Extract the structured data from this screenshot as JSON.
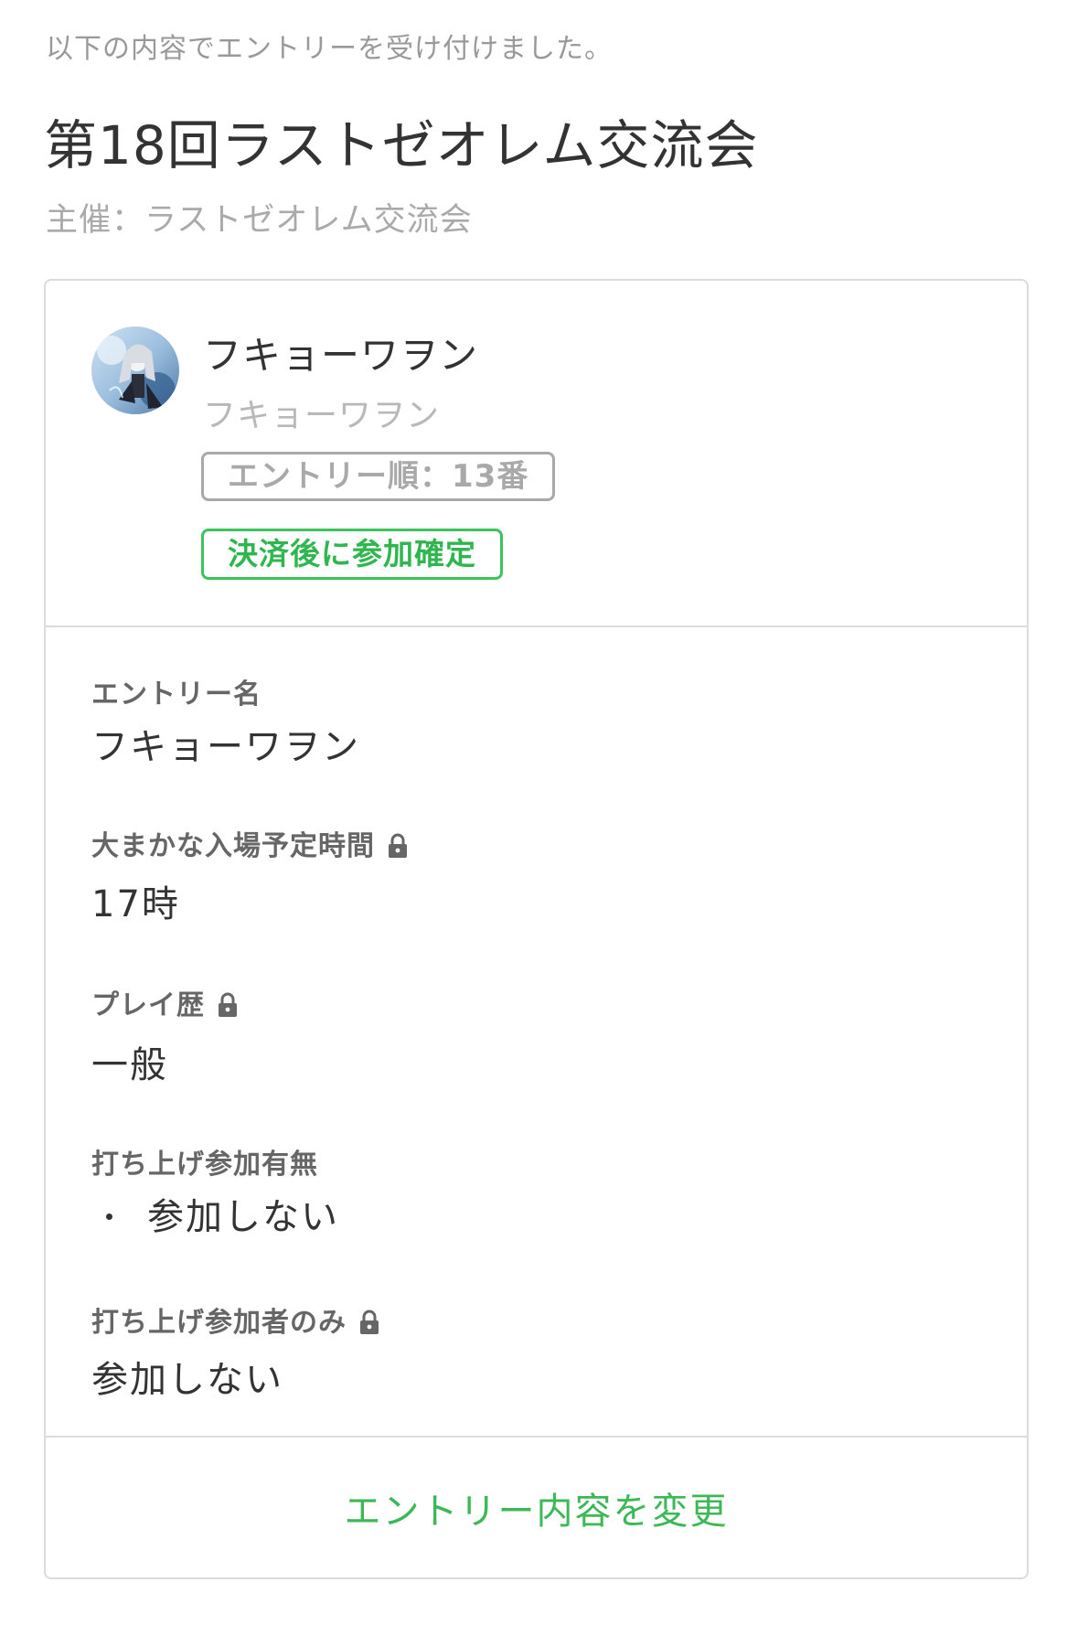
{
  "notice": "以下の内容でエントリーを受け付けました。",
  "event": {
    "title": "第18回ラストゼオレム交流会",
    "organizer": "主催：ラストゼオレム交流会"
  },
  "profile": {
    "display_name": "フキョーワヲン",
    "account_name": "フキョーワヲン",
    "entry_order_badge": "エントリー順：13番",
    "status_badge": "決済後に参加確定"
  },
  "fields": [
    {
      "label": "エントリー名",
      "value": "フキョーワヲン",
      "locked": false
    },
    {
      "label": "大まかな入場予定時間",
      "value": "17時",
      "locked": true
    },
    {
      "label": "プレイ歴",
      "value": "一般",
      "locked": true
    },
    {
      "label": "打ち上げ参加有無",
      "value": "参加しない",
      "locked": false,
      "bulleted": true
    },
    {
      "label": "打ち上げ参加者のみ",
      "value": "参加しない",
      "locked": true
    }
  ],
  "footer": {
    "edit_label": "エントリー内容を変更"
  },
  "colors": {
    "accent_green": "#3cb856",
    "badge_gray": "#a9a9a9",
    "border": "#dcdcdc"
  },
  "icons": {
    "lock": "lock-icon",
    "avatar": "user-avatar"
  }
}
